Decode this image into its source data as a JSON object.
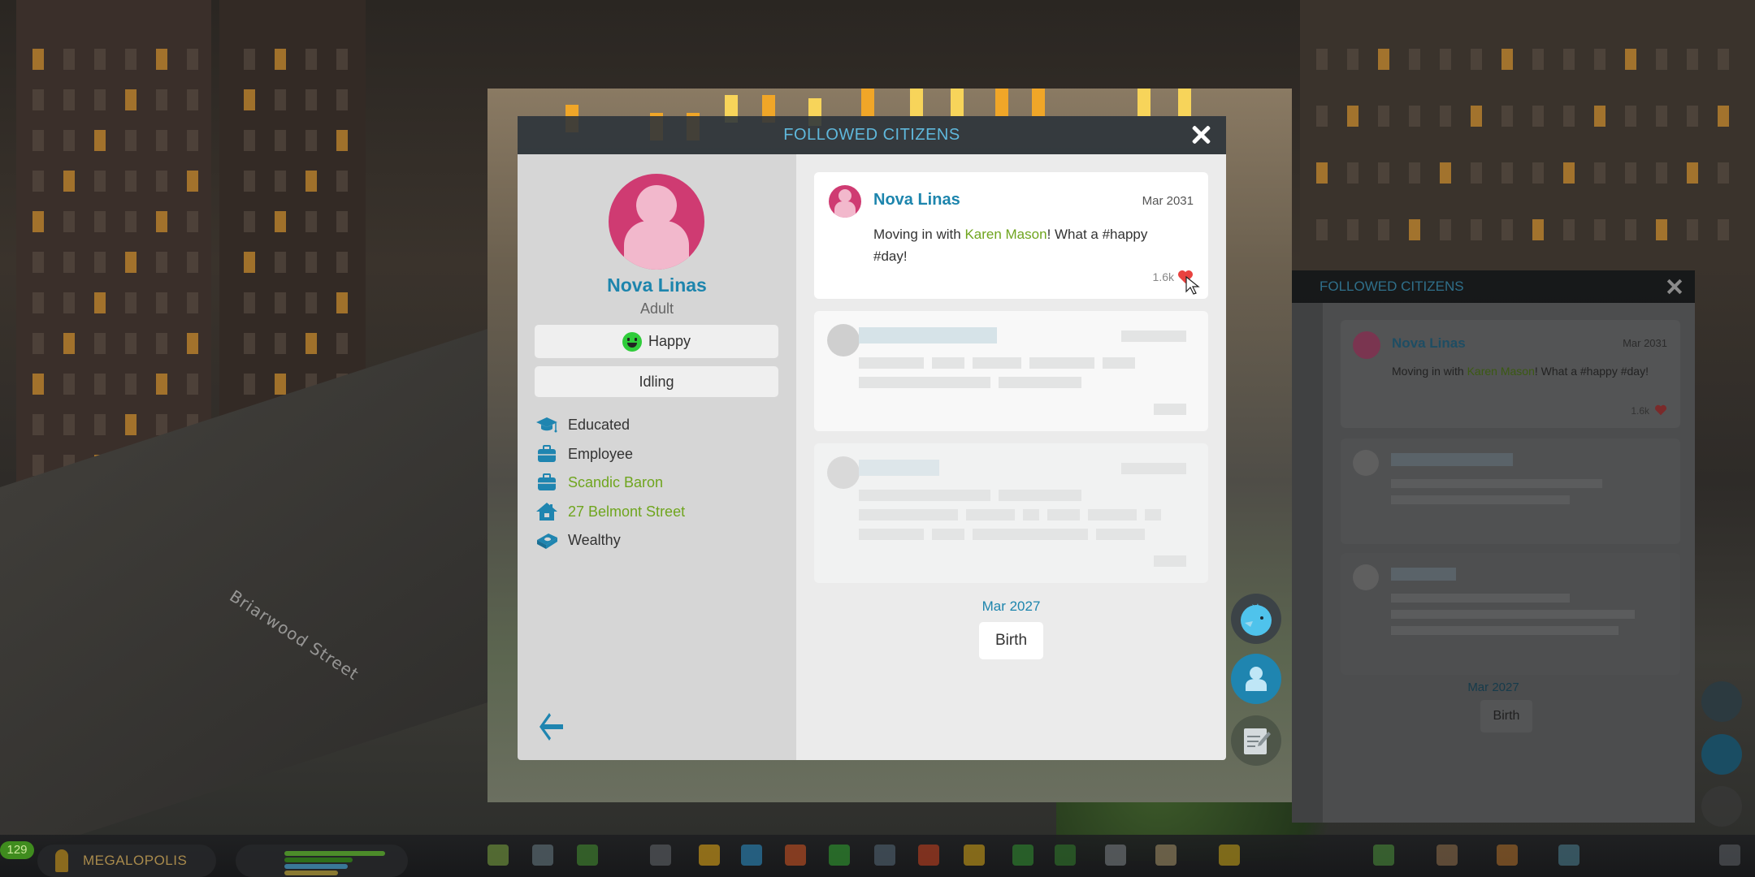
{
  "window": {
    "title": "FOLLOWED CITIZENS",
    "close_icon": "close-icon"
  },
  "citizen": {
    "name": "Nova Linas",
    "age_group": "Adult",
    "happiness": "Happy",
    "happiness_icon": "happy-face-icon",
    "activity": "Idling",
    "attributes": [
      {
        "icon": "graduation-cap-icon",
        "label": "Educated",
        "link": false
      },
      {
        "icon": "briefcase-icon",
        "label": "Employee",
        "link": false
      },
      {
        "icon": "briefcase-icon",
        "label": "Scandic Baron",
        "link": true
      },
      {
        "icon": "house-icon",
        "label": "27 Belmont Street",
        "link": true
      },
      {
        "icon": "money-stack-icon",
        "label": "Wealthy",
        "link": false
      }
    ],
    "back_icon": "back-arrow-icon"
  },
  "feed": {
    "posts": [
      {
        "author": "Nova Linas",
        "date": "Mar 2031",
        "text_before": "Moving in with ",
        "mention": "Karen Mason",
        "text_after": "! What a #happy #day!",
        "likes": "1.6k",
        "like_icon": "heart-icon"
      }
    ],
    "loading_placeholders": 2,
    "timeline": {
      "date": "Mar 2027",
      "event": "Birth"
    }
  },
  "side_buttons": [
    {
      "icon": "chirper-bird-icon",
      "label": "Chirper"
    },
    {
      "icon": "person-icon",
      "label": "Followed Citizens"
    },
    {
      "icon": "notes-icon",
      "label": "Journal"
    }
  ],
  "background_window": {
    "title": "FOLLOWED CITIZENS",
    "post_author": "Nova Linas",
    "post_date": "Mar 2031",
    "post_text_before": "Moving in with ",
    "post_mention": "Karen Mason",
    "post_text_after": "! What a #happy #day!",
    "post_likes": "1.6k",
    "timeline_date": "Mar 2027",
    "timeline_event": "Birth"
  },
  "world": {
    "street_name": "Briarwood Street"
  },
  "toolbar": {
    "level": "129",
    "milestone": "MEGALOPOLIS",
    "tools_left": [
      "zoning-icon",
      "areas-icon",
      "signature-buildings-icon",
      "roads-icon",
      "electricity-icon",
      "water-icon",
      "health-icon",
      "garbage-icon",
      "education-icon",
      "fire-icon",
      "police-icon",
      "transport-icon",
      "parks-icon",
      "chirper-messages-icon",
      "landscaping-icon",
      "bulldozer-icon"
    ],
    "tools_right": [
      "economy-icon",
      "map-tiles-icon",
      "statistics-icon",
      "city-services-icon",
      "photo-mode-icon"
    ]
  }
}
